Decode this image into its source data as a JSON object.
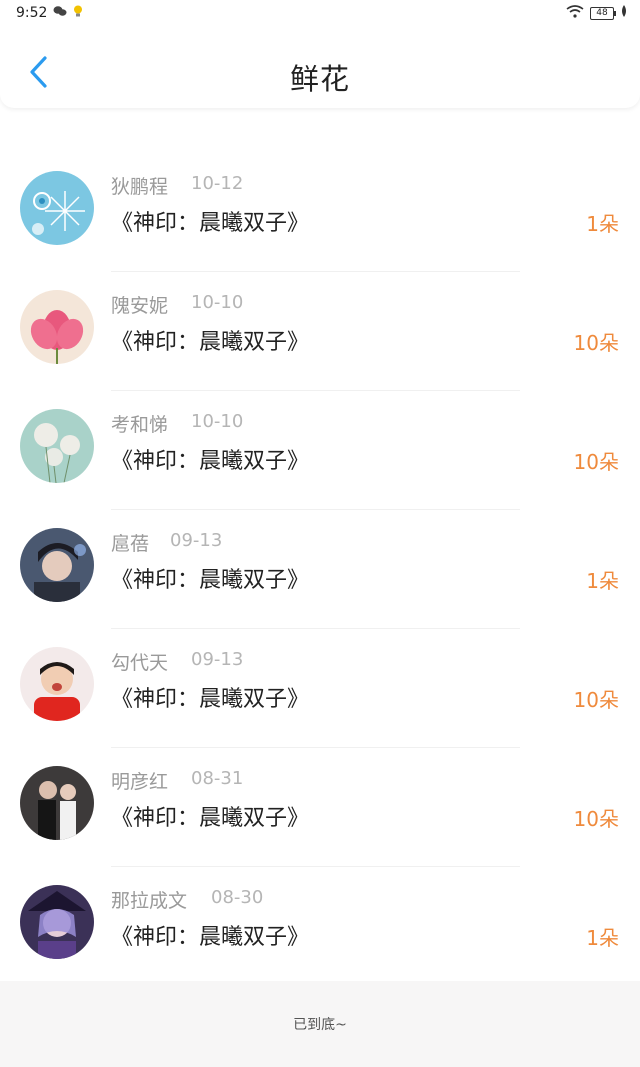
{
  "status": {
    "time": "9:52",
    "battery": "48"
  },
  "header": {
    "title": "鲜花"
  },
  "list": [
    {
      "name": "",
      "date": "",
      "book": "《神印：晨曦双子》",
      "count": "10朵",
      "avatar": "avatar-partial"
    },
    {
      "name": "狄鹏程",
      "date": "10-12",
      "book": "《神印：晨曦双子》",
      "count": "1朵",
      "avatar": "snowflake-blue"
    },
    {
      "name": "隗安妮",
      "date": "10-10",
      "book": "《神印：晨曦双子》",
      "count": "10朵",
      "avatar": "lotus-flower"
    },
    {
      "name": "考和悌",
      "date": "10-10",
      "book": "《神印：晨曦双子》",
      "count": "10朵",
      "avatar": "dandelion"
    },
    {
      "name": "扈蓓",
      "date": "09-13",
      "book": "《神印：晨曦双子》",
      "count": "1朵",
      "avatar": "young-man"
    },
    {
      "name": "勾代天",
      "date": "09-13",
      "book": "《神印：晨曦双子》",
      "count": "10朵",
      "avatar": "child"
    },
    {
      "name": "明彦红",
      "date": "08-31",
      "book": "《神印：晨曦双子》",
      "count": "10朵",
      "avatar": "couple"
    },
    {
      "name": "那拉成文",
      "date": "08-30",
      "book": "《神印：晨曦双子》",
      "count": "1朵",
      "avatar": "anime-character"
    }
  ],
  "footer": {
    "text": "已到底~"
  },
  "colors": {
    "accent": "#2b9bef",
    "count": "#ef8a3c",
    "footer_bg": "#f7f6f6"
  }
}
